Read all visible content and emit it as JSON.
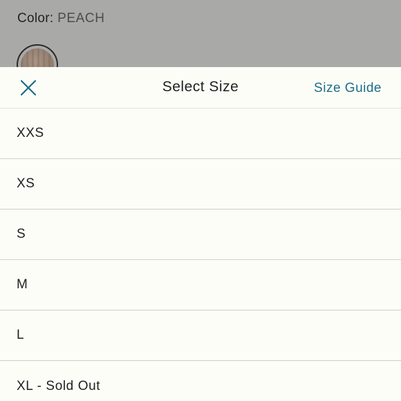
{
  "product": {
    "color_label": "Color:",
    "color_value": "PEACH"
  },
  "sheet": {
    "title": "Select Size",
    "size_guide_label": "Size Guide",
    "accent_color": "#1c6e85"
  },
  "icons": {
    "close": "close-icon",
    "swatch": "color-swatch"
  },
  "sizes": [
    {
      "label": "XXS"
    },
    {
      "label": "XS"
    },
    {
      "label": "S"
    },
    {
      "label": "M"
    },
    {
      "label": "L"
    },
    {
      "label": "XL - Sold Out"
    }
  ]
}
